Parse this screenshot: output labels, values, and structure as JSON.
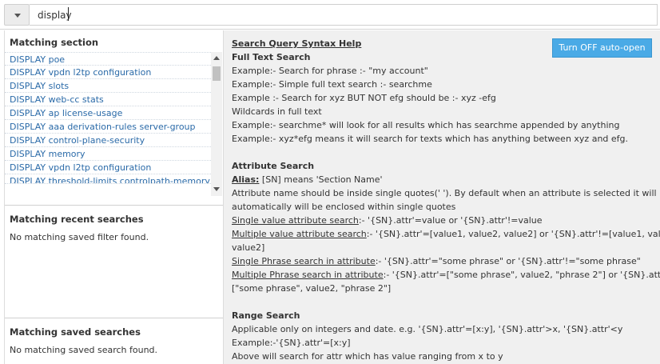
{
  "search": {
    "value": "display",
    "placeholder": ""
  },
  "left": {
    "matching_section_title": "Matching section",
    "sections": [
      "DISPLAY poe",
      "DISPLAY vpdn l2tp configuration",
      "DISPLAY slots",
      "DISPLAY web-cc stats",
      "DISPLAY ap license-usage",
      "DISPLAY aaa derivation-rules server-group",
      "DISPLAY control-plane-security",
      "DISPLAY memory",
      "DISPLAY vpdn l2tp configuration",
      "DISPLAY threshold-limits controlpath-memory"
    ],
    "recent_title": "Matching recent searches",
    "recent_empty": "No matching saved filter found.",
    "saved_title": "Matching saved searches",
    "saved_empty": "No matching saved search found."
  },
  "help": {
    "turn_off_button": "Turn OFF auto-open",
    "title": "Search Query Syntax Help",
    "full_text": {
      "heading": "Full Text Search",
      "lines": [
        "Example:- Search for phrase :- \"my account\"",
        "Example:- Simple full text search :- searchme",
        "Example :- Search for xyz BUT NOT efg should be :- xyz -efg",
        "Wildcards in full text",
        "Example:- searchme* will look for all results which has searchme appended by anything",
        "Example:- xyz*efg means it will search for texts which has anything between xyz and efg."
      ]
    },
    "attribute": {
      "heading": "Attribute Search",
      "alias_label": "Alias:",
      "alias_text": " [SN] means 'Section Name'",
      "note_1": "Attribute name should be inside single quotes(' '). By default when an attribute is selected it will",
      "note_2": "automatically will be enclosed within single quotes",
      "single_value_label": "Single value attribute search",
      "single_value_text": ":- '{SN}.attr'=value or '{SN}.attr'!=value",
      "multi_value_label": "Multiple value attribute search",
      "multi_value_text": ":- '{SN}.attr'=[value1, value2, value2] or '{SN}.attr'!=[value1, value2,",
      "multi_value_cont": "value2]",
      "single_phrase_label": "Single Phrase search in attribute",
      "single_phrase_text": ":- '{SN}.attr'=\"some phrase\" or '{SN}.attr'!=\"some phrase\"",
      "multi_phrase_label": "Multiple Phrase search in attribute",
      "multi_phrase_text": ":- '{SN}.attr'=[\"some phrase\", value2, \"phrase 2\"] or '{SN}.attr'!=",
      "multi_phrase_cont": "[\"some phrase\", value2, \"phrase 2\"]"
    },
    "range": {
      "heading": "Range Search",
      "lines": [
        "Applicable only on integers and date. e.g. '{SN}.attr'=[x:y], '{SN}.attr'>x, '{SN}.attr'<y",
        "Example:-'{SN}.attr'=[x:y]",
        "Above will search for attr which has value ranging from x to y"
      ]
    }
  },
  "colors": {
    "link": "#2a6aa8",
    "button": "#4aaae6",
    "help_bg": "#f0f0f0"
  },
  "icons": {
    "dropdown": "triangle-down-icon",
    "scroll_up": "scroll-up-icon",
    "scroll_down": "scroll-down-icon"
  }
}
